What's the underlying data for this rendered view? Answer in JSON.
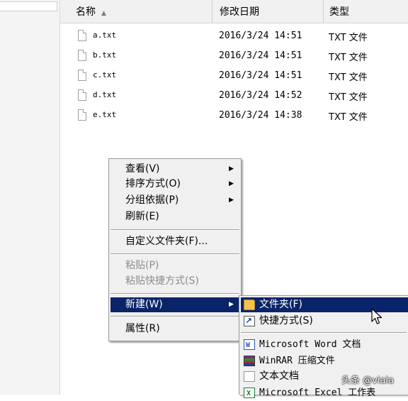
{
  "columns": {
    "name": "名称",
    "date": "修改日期",
    "type": "类型"
  },
  "files": [
    {
      "name": "a.txt",
      "date": "2016/3/24 14:51",
      "type": "TXT 文件"
    },
    {
      "name": "b.txt",
      "date": "2016/3/24 14:51",
      "type": "TXT 文件"
    },
    {
      "name": "c.txt",
      "date": "2016/3/24 14:51",
      "type": "TXT 文件"
    },
    {
      "name": "d.txt",
      "date": "2016/3/24 14:52",
      "type": "TXT 文件"
    },
    {
      "name": "e.txt",
      "date": "2016/3/24 14:38",
      "type": "TXT 文件"
    }
  ],
  "context_menu": {
    "view": "查看(V)",
    "sort": "排序方式(O)",
    "group": "分组依据(P)",
    "refresh": "刷新(E)",
    "customize": "自定义文件夹(F)...",
    "paste": "粘贴(P)",
    "paste_shortcut": "粘贴快捷方式(S)",
    "new": "新建(W)",
    "properties": "属性(R)"
  },
  "new_submenu": {
    "folder": "文件夹(F)",
    "shortcut": "快捷方式(S)",
    "word": "Microsoft Word 文档",
    "winrar": "WinRAR 压缩文件",
    "text": "文本文档",
    "excel": "Microsoft Excel 工作表"
  },
  "watermark": "头条 @viala",
  "colors": {
    "highlight": "#0a246a",
    "menu_bg": "#f0f0f0",
    "disabled_text": "#8d8d8d"
  }
}
